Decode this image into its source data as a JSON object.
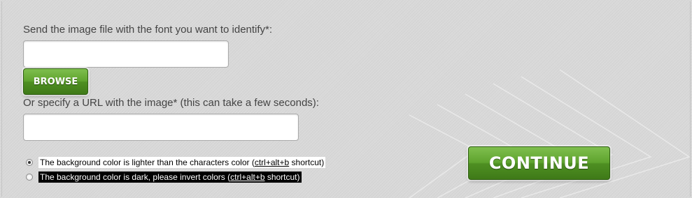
{
  "form": {
    "file_label": "Send the image file with the font you want to identify*:",
    "file_value": "",
    "browse_label": "BROWSE",
    "url_label": "Or specify a URL with the image* (this can take a few seconds):",
    "url_value": "",
    "continue_label": "CONTINUE"
  },
  "options": {
    "light": {
      "selected": true,
      "text_before": "The background color is lighter than the characters color (",
      "shortcut": "ctrl+alt+b",
      "text_after": " shortcut)"
    },
    "dark": {
      "selected": false,
      "text_before": "The background color is dark, please invert colors (",
      "shortcut": "ctrl+alt+b",
      "text_after": " shortcut)"
    }
  },
  "colors": {
    "page_background": "#d9d9d9",
    "button_green": "#5fa32e",
    "dark_option_background": "#000000"
  }
}
